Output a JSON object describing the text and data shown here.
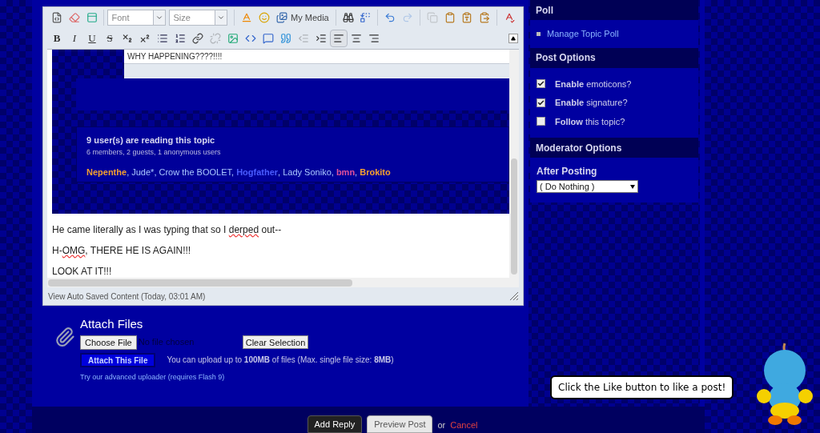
{
  "editor": {
    "toolbar_rows": [
      [
        {
          "kind": "source"
        },
        {
          "kind": "eraser"
        },
        {
          "kind": "template"
        },
        {
          "kind": "separator"
        },
        {
          "kind": "select",
          "placeholder": "Font"
        },
        {
          "kind": "select",
          "placeholder": "Size"
        },
        {
          "kind": "separator"
        },
        {
          "kind": "text-color"
        },
        {
          "kind": "emoticon"
        },
        {
          "kind": "media",
          "label": "My Media"
        },
        {
          "kind": "separator"
        },
        {
          "kind": "find"
        },
        {
          "kind": "replace"
        },
        {
          "kind": "separator"
        },
        {
          "kind": "undo",
          "disabled": false
        },
        {
          "kind": "redo",
          "disabled": true
        },
        {
          "kind": "separator"
        },
        {
          "kind": "copy",
          "disabled": true
        },
        {
          "kind": "paste",
          "disabled": false
        },
        {
          "kind": "paste-text",
          "disabled": false
        },
        {
          "kind": "paste-word",
          "disabled": false
        },
        {
          "kind": "separator"
        },
        {
          "kind": "spellcheck"
        }
      ],
      [
        {
          "kind": "bold",
          "label": "B"
        },
        {
          "kind": "italic",
          "label": "I"
        },
        {
          "kind": "underline",
          "label": "U"
        },
        {
          "kind": "strike",
          "label": "S"
        },
        {
          "kind": "subscript"
        },
        {
          "kind": "superscript"
        },
        {
          "kind": "bullets"
        },
        {
          "kind": "numbers"
        },
        {
          "kind": "link"
        },
        {
          "kind": "unlink",
          "disabled": true
        },
        {
          "kind": "image"
        },
        {
          "kind": "code"
        },
        {
          "kind": "quote"
        },
        {
          "kind": "tweet"
        },
        {
          "kind": "outdent",
          "disabled": true
        },
        {
          "kind": "indent",
          "disabled": false
        },
        {
          "kind": "align-left",
          "selected": true
        },
        {
          "kind": "align-center",
          "selected": false
        },
        {
          "kind": "align-right",
          "selected": false
        }
      ]
    ],
    "quoted_text": "WHY HAPPENING????!!!!",
    "readers": {
      "title": "9 user(s) are reading this topic",
      "summary": "6 members, 2 guests, 1 anonymous users",
      "separator": ", ",
      "names": [
        {
          "name": "Nepenthe",
          "color": "#f5a030",
          "bold": true
        },
        {
          "name": "Jude*",
          "color": "#aac8ff",
          "bold": false
        },
        {
          "name": "Crow the BOOLET",
          "color": "#aac8ff",
          "bold": false
        },
        {
          "name": "Hogfather",
          "color": "#4a5cff",
          "bold": true
        },
        {
          "name": "Lady Soniko",
          "color": "#aac8ff",
          "bold": false
        },
        {
          "name": "bmn",
          "color": "#e0509a",
          "bold": true
        },
        {
          "name": "Brokito",
          "color": "#f5a030",
          "bold": true
        }
      ]
    },
    "paragraphs": [
      [
        {
          "text": "He came literally as I was typing that so I ",
          "misspelled": false
        },
        {
          "text": "derped",
          "misspelled": true
        },
        {
          "text": " out--",
          "misspelled": false
        }
      ],
      [
        {
          "text": "H-",
          "misspelled": false
        },
        {
          "text": "OMG",
          "misspelled": true
        },
        {
          "text": ", THERE HE IS AGAIN!!!",
          "misspelled": false
        }
      ],
      [
        {
          "text": "LOOK AT IT!!!",
          "misspelled": false
        }
      ]
    ],
    "autosave": "View Auto Saved Content (Today, 03:01 AM)"
  },
  "attach": {
    "title": "Attach Files",
    "choose_button": "Choose File",
    "file_status": "No file chosen",
    "clear_button": "Clear Selection",
    "attach_button": "Attach This File",
    "info": "You can upload up to **100MB** of files (Max. single file size: **8MB**)",
    "advanced_link": "Try our advanced uploader (requires Flash 9)"
  },
  "sidebar": {
    "sections": [
      {
        "title": "Poll",
        "kind": "links",
        "items": [
          {
            "label": "Manage Topic Poll"
          }
        ]
      },
      {
        "title": "Post Options",
        "kind": "checkboxes",
        "items": [
          {
            "label": "**Enable** emoticons?",
            "checked": true
          },
          {
            "label": "**Enable** signature?",
            "checked": true
          },
          {
            "label": "**Follow** this topic?",
            "checked": false
          }
        ]
      },
      {
        "title": "Moderator Options",
        "kind": "select",
        "label": "After Posting",
        "value": "( Do Nothing )"
      }
    ]
  },
  "actions": {
    "add_reply": "Add Reply",
    "preview": "Preview Post",
    "or": "or",
    "cancel": "Cancel"
  },
  "tooltip": "Click the Like button to like a post!"
}
